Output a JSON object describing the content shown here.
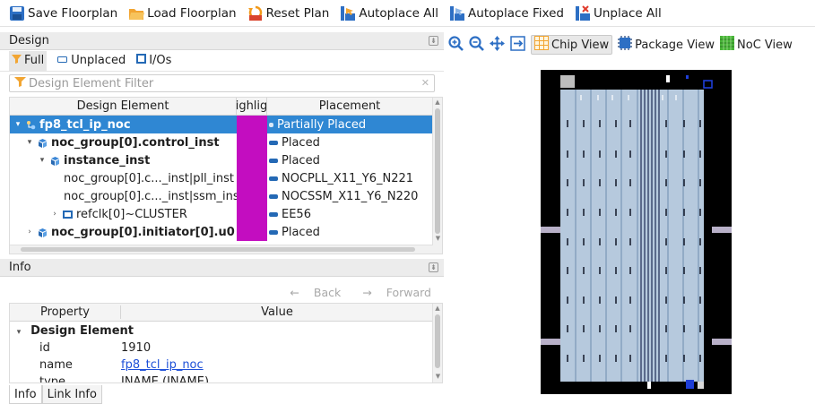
{
  "toolbar": {
    "buttons": [
      {
        "label": "Save Floorplan",
        "icon": "save-icon"
      },
      {
        "label": "Load Floorplan",
        "icon": "folder-open-icon"
      },
      {
        "label": "Reset Plan",
        "icon": "reset-icon"
      },
      {
        "label": "Autoplace All",
        "icon": "autoplace-icon"
      },
      {
        "label": "Autoplace Fixed",
        "icon": "autoplace-fixed-icon"
      },
      {
        "label": "Unplace All",
        "icon": "unplace-icon"
      }
    ]
  },
  "design_panel": {
    "title": "Design",
    "filters": {
      "full": "Full",
      "unplaced": "Unplaced",
      "ios": "I/Os"
    },
    "filter_placeholder": "Design Element Filter",
    "columns": {
      "element": "Design Element",
      "highlight": "ighlig",
      "placement": "Placement"
    },
    "rows": [
      {
        "name": "fp8_tcl_ip_noc",
        "placement": "Partially Placed",
        "bold": true,
        "expander": "▾"
      },
      {
        "name": "noc_group[0].control_inst",
        "placement": "Placed",
        "bold": true,
        "expander": "▾"
      },
      {
        "name": "instance_inst",
        "placement": "Placed",
        "bold": true,
        "expander": "▾"
      },
      {
        "name": "noc_group[0].c..._inst|pll_inst",
        "placement": "NOCPLL_X11_Y6_N221",
        "bold": false,
        "expander": ""
      },
      {
        "name": "noc_group[0].c..._inst|ssm_inst",
        "placement": "NOCSSM_X11_Y6_N220",
        "bold": false,
        "expander": ""
      },
      {
        "name": "refclk[0]~CLUSTER",
        "placement": "EE56",
        "bold": false,
        "expander": "›"
      },
      {
        "name": "noc_group[0].initiator[0].u0",
        "placement": "Placed",
        "bold": true,
        "expander": "›"
      }
    ]
  },
  "info_panel": {
    "title": "Info",
    "back": "Back",
    "forward": "Forward",
    "columns": {
      "property": "Property",
      "value": "Value"
    },
    "section": "Design Element",
    "properties": [
      {
        "key": "id",
        "value": "1910"
      },
      {
        "key": "name",
        "value": "fp8_tcl_ip_noc"
      },
      {
        "key": "type",
        "value": "INAME (INAME)"
      }
    ],
    "tabs": [
      "Info",
      "Link Info"
    ]
  },
  "view_toolbar": {
    "chip_view": "Chip View",
    "package_view": "Package View",
    "noc_view": "NoC View"
  },
  "colors": {
    "selection": "#2f87d3",
    "highlight": "#c30dc0",
    "placement_marker": "#2469b5",
    "chip_background": "#000000",
    "chip_region": "#b4c8dc"
  }
}
